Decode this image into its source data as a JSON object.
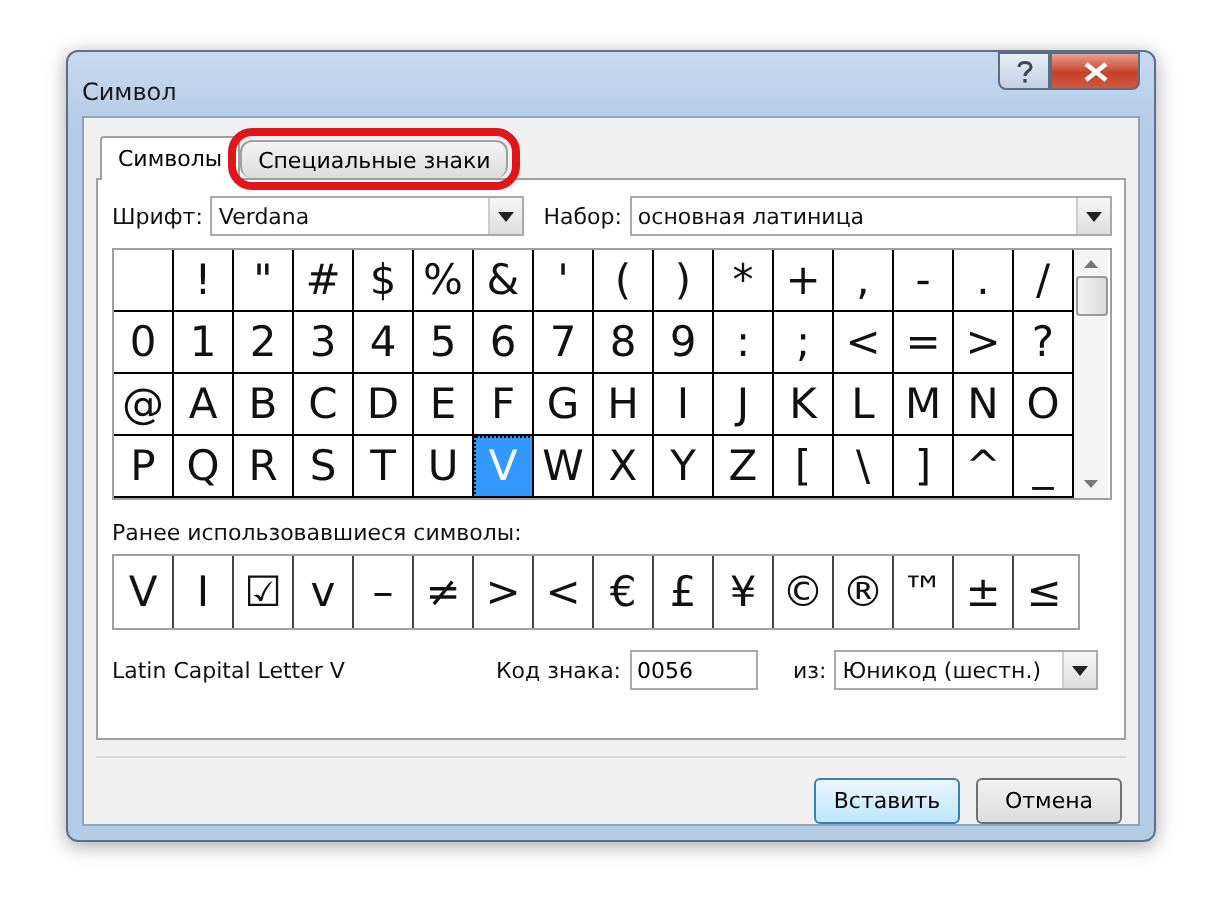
{
  "window": {
    "title": "Символ"
  },
  "tabs": [
    {
      "label": "Символы",
      "selected": true,
      "highlighted": false
    },
    {
      "label": "Специальные знаки",
      "selected": false,
      "highlighted": true
    }
  ],
  "font": {
    "label": "Шрифт:",
    "value": "Verdana"
  },
  "subset": {
    "label": "Набор:",
    "value": "основная латиница"
  },
  "symbols": [
    [
      {
        "selected": false
      },
      {
        "char": "!",
        "selected": false
      },
      {
        "char": "\"",
        "selected": false
      },
      {
        "char": "#",
        "selected": false
      },
      {
        "char": "$",
        "selected": false
      },
      {
        "char": "%",
        "selected": false
      },
      {
        "char": "&",
        "selected": false
      },
      {
        "char": "'",
        "selected": false
      },
      {
        "char": "(",
        "selected": false
      },
      {
        "char": ")",
        "selected": false
      },
      {
        "char": "*",
        "selected": false
      },
      {
        "char": "+",
        "selected": false
      },
      {
        "char": ",",
        "selected": false
      },
      {
        "char": "-",
        "selected": false
      },
      {
        "char": ".",
        "selected": false
      },
      {
        "char": "/",
        "selected": false
      }
    ],
    [
      {
        "char": "0",
        "selected": false
      },
      {
        "char": "1",
        "selected": false
      },
      {
        "char": "2",
        "selected": false
      },
      {
        "char": "3",
        "selected": false
      },
      {
        "char": "4",
        "selected": false
      },
      {
        "char": "5",
        "selected": false
      },
      {
        "char": "6",
        "selected": false
      },
      {
        "char": "7",
        "selected": false
      },
      {
        "char": "8",
        "selected": false
      },
      {
        "char": "9",
        "selected": false
      },
      {
        "char": ":",
        "selected": false
      },
      {
        "char": ";",
        "selected": false
      },
      {
        "char": "<",
        "selected": false
      },
      {
        "char": "=",
        "selected": false
      },
      {
        "char": ">",
        "selected": false
      },
      {
        "char": "?",
        "selected": false
      }
    ],
    [
      {
        "char": "@",
        "selected": false
      },
      {
        "char": "A",
        "selected": false
      },
      {
        "char": "B",
        "selected": false
      },
      {
        "char": "C",
        "selected": false
      },
      {
        "char": "D",
        "selected": false
      },
      {
        "char": "E",
        "selected": false
      },
      {
        "char": "F",
        "selected": false
      },
      {
        "char": "G",
        "selected": false
      },
      {
        "char": "H",
        "selected": false
      },
      {
        "char": "I",
        "selected": false
      },
      {
        "char": "J",
        "selected": false
      },
      {
        "char": "K",
        "selected": false
      },
      {
        "char": "L",
        "selected": false
      },
      {
        "char": "M",
        "selected": false
      },
      {
        "char": "N",
        "selected": false
      },
      {
        "char": "O",
        "selected": false
      }
    ],
    [
      {
        "char": "P",
        "selected": false
      },
      {
        "char": "Q",
        "selected": false
      },
      {
        "char": "R",
        "selected": false
      },
      {
        "char": "S",
        "selected": false
      },
      {
        "char": "T",
        "selected": false
      },
      {
        "char": "U",
        "selected": false
      },
      {
        "char": "V",
        "selected": true
      },
      {
        "char": "W",
        "selected": false
      },
      {
        "char": "X",
        "selected": false
      },
      {
        "char": "Y",
        "selected": false
      },
      {
        "char": "Z",
        "selected": false
      },
      {
        "char": "[",
        "selected": false
      },
      {
        "char": "\\",
        "selected": false
      },
      {
        "char": "]",
        "selected": false
      },
      {
        "char": "^",
        "selected": false
      },
      {
        "char": "_",
        "selected": false
      }
    ]
  ],
  "recent_label": "Ранее использовавшиеся символы:",
  "recent": [
    "V",
    "I",
    "☑",
    "v",
    "–",
    "≠",
    ">",
    "<",
    "€",
    "£",
    "¥",
    "©",
    "®",
    "™",
    "±",
    "≤"
  ],
  "char_name": "Latin Capital Letter V",
  "code": {
    "label": "Код знака:",
    "value": "0056"
  },
  "from": {
    "label": "из:",
    "value": "Юникод (шестн.)"
  },
  "buttons": [
    {
      "label": "Вставить",
      "default": true
    },
    {
      "label": "Отмена",
      "default": false
    }
  ]
}
